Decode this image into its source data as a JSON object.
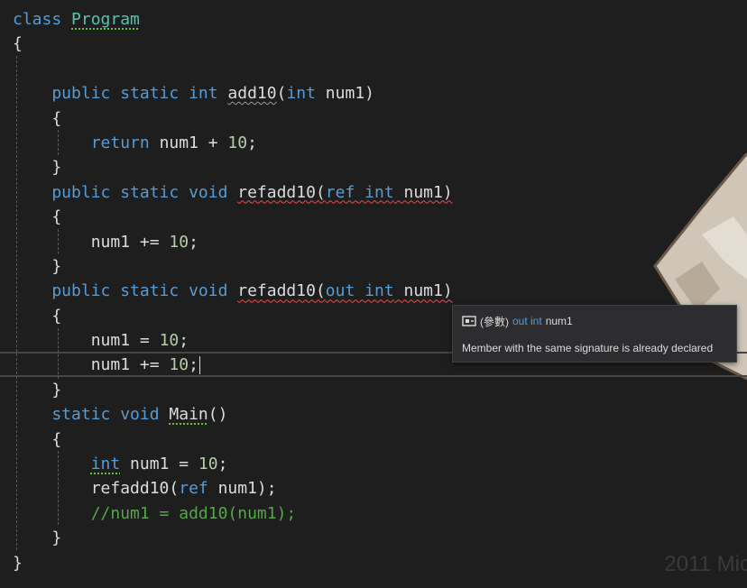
{
  "code_lines": [
    [
      {
        "t": "class ",
        "c": "kw"
      },
      {
        "t": "Program",
        "c": "type",
        "sq": "green"
      }
    ],
    [
      {
        "t": "{",
        "c": "plain"
      }
    ],
    [
      {
        "t": "",
        "c": "plain"
      }
    ],
    [
      {
        "t": "    public static int ",
        "c": "kw"
      },
      {
        "t": "add10",
        "c": "plain",
        "sq": "gray"
      },
      {
        "t": "(",
        "c": "plain"
      },
      {
        "t": "int",
        "c": "kw"
      },
      {
        "t": " num1)",
        "c": "plain"
      }
    ],
    [
      {
        "t": "    {",
        "c": "plain"
      }
    ],
    [
      {
        "t": "        return ",
        "c": "kw"
      },
      {
        "t": "num1 + ",
        "c": "plain"
      },
      {
        "t": "10",
        "c": "num"
      },
      {
        "t": ";",
        "c": "plain"
      }
    ],
    [
      {
        "t": "    }",
        "c": "plain"
      }
    ],
    [
      {
        "t": "    public static void ",
        "c": "kw"
      },
      {
        "t": "refadd10(",
        "c": "plain",
        "sq": "red"
      },
      {
        "t": "ref int",
        "c": "kw",
        "sq": "red"
      },
      {
        "t": " num1)",
        "c": "plain",
        "sq": "red"
      }
    ],
    [
      {
        "t": "    {",
        "c": "plain"
      }
    ],
    [
      {
        "t": "        num1 += ",
        "c": "plain"
      },
      {
        "t": "10",
        "c": "num"
      },
      {
        "t": ";",
        "c": "plain"
      }
    ],
    [
      {
        "t": "    }",
        "c": "plain"
      }
    ],
    [
      {
        "t": "    public static void ",
        "c": "kw"
      },
      {
        "t": "refadd10(",
        "c": "plain",
        "sq": "red"
      },
      {
        "t": "out int",
        "c": "kw",
        "sq": "red"
      },
      {
        "t": " num1)",
        "c": "plain",
        "sq": "red"
      }
    ],
    [
      {
        "t": "    {",
        "c": "plain"
      }
    ],
    [
      {
        "t": "        num1 = ",
        "c": "plain"
      },
      {
        "t": "10",
        "c": "num"
      },
      {
        "t": ";",
        "c": "plain"
      }
    ],
    [
      {
        "t": "        num1 += ",
        "c": "plain"
      },
      {
        "t": "10",
        "c": "num"
      },
      {
        "t": ";",
        "c": "plain"
      }
    ],
    [
      {
        "t": "    }",
        "c": "plain"
      }
    ],
    [
      {
        "t": "    static void ",
        "c": "kw"
      },
      {
        "t": "Main",
        "c": "plain",
        "sq": "green"
      },
      {
        "t": "()",
        "c": "plain"
      }
    ],
    [
      {
        "t": "    {",
        "c": "plain"
      }
    ],
    [
      {
        "t": "        ",
        "c": "plain"
      },
      {
        "t": "int",
        "c": "kw",
        "sq": "green"
      },
      {
        "t": " num1 = ",
        "c": "plain"
      },
      {
        "t": "10",
        "c": "num"
      },
      {
        "t": ";",
        "c": "plain"
      }
    ],
    [
      {
        "t": "        refadd10(",
        "c": "plain"
      },
      {
        "t": "ref",
        "c": "kw"
      },
      {
        "t": " num1);",
        "c": "plain"
      }
    ],
    [
      {
        "t": "        //num1 = add10(num1);",
        "c": "cmt"
      }
    ],
    [
      {
        "t": "    }",
        "c": "plain"
      }
    ],
    [
      {
        "t": "}",
        "c": "plain"
      }
    ]
  ],
  "caret_line": 14,
  "tooltip": {
    "icon": "parameter-icon",
    "category": "(參數)",
    "modifier": "out int",
    "name": "num1",
    "message": "Member with the same signature is already declared"
  },
  "watermark": "2011 Mic",
  "colors": {
    "background": "#1e1e1e",
    "keyword": "#569cd6",
    "type": "#4ec9b0",
    "number": "#b5cea8",
    "comment": "#57a64a",
    "text": "#dcdcdc",
    "error_squiggle": "#f14c4c",
    "tooltip_bg": "#2d2d30"
  }
}
